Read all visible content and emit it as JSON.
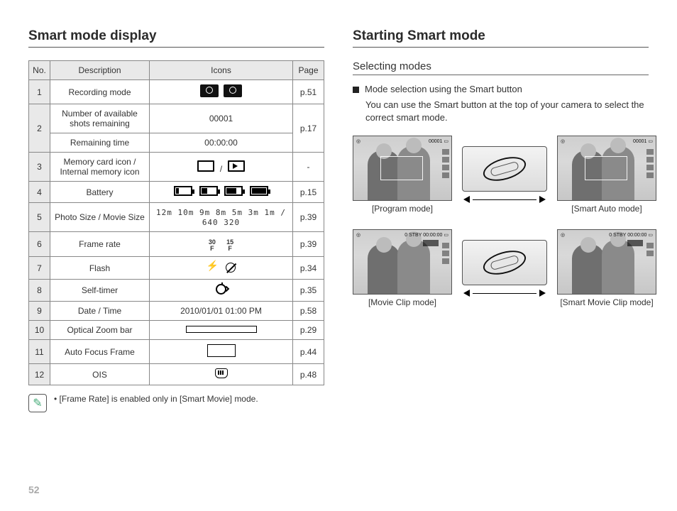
{
  "page_number": "52",
  "left": {
    "title": "Smart mode display",
    "headers": {
      "no": "No.",
      "desc": "Description",
      "icons": "Icons",
      "page": "Page"
    },
    "rows": [
      {
        "no": "1",
        "desc": "Recording mode",
        "icon_type": "mode",
        "page": "p.51"
      },
      {
        "no": "2",
        "desc": "Number of available shots remaining",
        "icon_text": "00001",
        "page": "p.17",
        "rowspan_no": true
      },
      {
        "no": "",
        "desc": "Remaining time",
        "icon_text": "00:00:00",
        "page": "",
        "merged": true
      },
      {
        "no": "3",
        "desc": "Memory card icon / Internal memory icon",
        "icon_type": "memory",
        "page": "-"
      },
      {
        "no": "4",
        "desc": "Battery",
        "icon_type": "battery",
        "page": "p.15"
      },
      {
        "no": "5",
        "desc": "Photo Size / Movie Size",
        "icon_type": "sizes",
        "page": "p.39"
      },
      {
        "no": "6",
        "desc": "Frame rate",
        "icon_type": "frate",
        "page": "p.39"
      },
      {
        "no": "7",
        "desc": "Flash",
        "icon_type": "flash",
        "page": "p.34"
      },
      {
        "no": "8",
        "desc": "Self-timer",
        "icon_type": "timer",
        "page": "p.35"
      },
      {
        "no": "9",
        "desc": "Date / Time",
        "icon_text": "2010/01/01  01:00 PM",
        "page": "p.58"
      },
      {
        "no": "10",
        "desc": "Optical Zoom bar",
        "icon_type": "bar",
        "page": "p.29"
      },
      {
        "no": "11",
        "desc": "Auto Focus Frame",
        "icon_type": "afframe",
        "page": "p.44"
      },
      {
        "no": "12",
        "desc": "OIS",
        "icon_type": "ois",
        "page": "p.48"
      }
    ],
    "sizes_text": "12m 10m 9m 8m 5m 3m 1m / 640 320",
    "frate": {
      "a": "30",
      "b": "15",
      "unit": "F"
    },
    "note_bullet": "•",
    "note": "[Frame Rate] is enabled only in [Smart Movie] mode."
  },
  "right": {
    "title": "Starting Smart mode",
    "subhead": "Selecting modes",
    "bullet": "Mode selection using the Smart button",
    "para": "You can use the Smart button at the top of your camera to select the correct smart mode.",
    "modes": {
      "program": "[Program mode]",
      "smart_auto": "[Smart Auto mode]",
      "movie": "[Movie Clip mode]",
      "smart_movie": "[Smart Movie Clip mode]"
    }
  }
}
